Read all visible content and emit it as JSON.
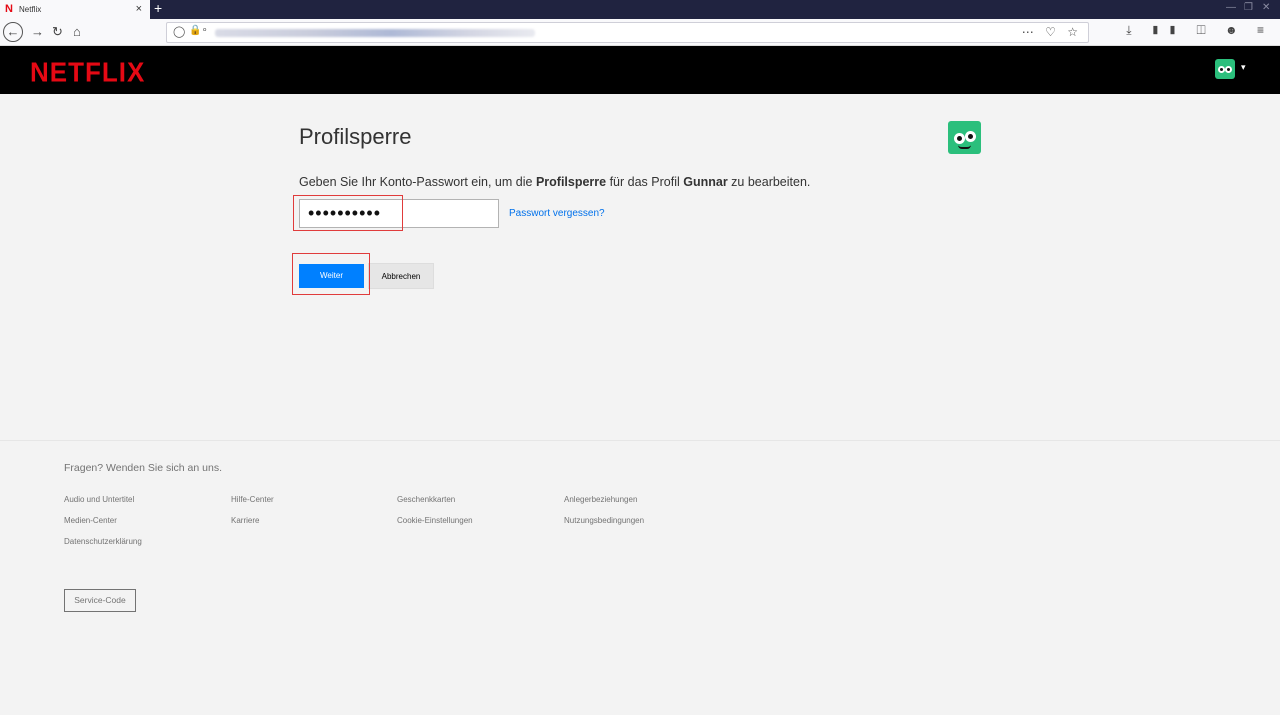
{
  "browser": {
    "tab_title": "Netflix",
    "tab_favicon": "netflix-n-icon",
    "tab_close": "×",
    "new_tab": "+",
    "url_icons": [
      "shield-icon",
      "lock-icon",
      "key-icon"
    ],
    "url_actions": [
      "more-icon",
      "pocket-icon",
      "bookmark-star-icon"
    ],
    "toolbar_icons": [
      "download-icon",
      "library-icon",
      "sidebar-icon",
      "account-icon",
      "menu-icon"
    ]
  },
  "header": {
    "logo": "NETFLIX",
    "logo_color": "#e50914",
    "avatar_icon": "profile-avatar-icon",
    "caret": "▾"
  },
  "main": {
    "title": "Profilsperre",
    "instruction": {
      "prefix": "Geben Sie Ihr Konto-Passwort ein, um die ",
      "bold1": "Profilsperre",
      "middle": " für das Profil ",
      "bold2": "Gunnar",
      "suffix": " zu bearbeiten."
    },
    "password_mask": "••••••••••",
    "forgot_link": "Passwort vergessen?",
    "continue_button": "Weiter",
    "cancel_button": "Abbrechen",
    "accent_color": "#0080ff"
  },
  "footer": {
    "title": "Fragen? Wenden Sie sich an uns.",
    "links": [
      "Audio und Untertitel",
      "Hilfe-Center",
      "Geschenkkarten",
      "Anlegerbeziehungen",
      "Medien-Center",
      "Karriere",
      "Cookie-Einstellungen",
      "Nutzungsbedingungen",
      "Datenschutzerklärung"
    ],
    "service_code": "Service-Code"
  }
}
